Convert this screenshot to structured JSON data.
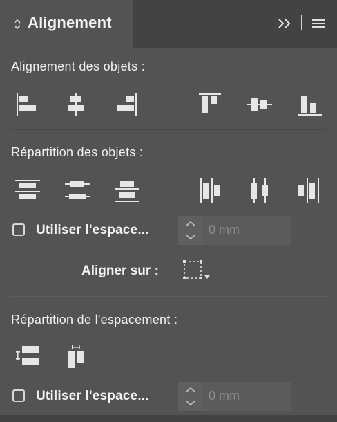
{
  "panel": {
    "tab_title": "Alignement",
    "expand_icon": "double-chevron-right-icon",
    "menu_icon": "hamburger-menu-icon"
  },
  "align_objects": {
    "title": "Alignement des objets :",
    "buttons": [
      {
        "name": "align-left-edges",
        "icon": "align-left-icon"
      },
      {
        "name": "align-horizontal-centers",
        "icon": "align-horizontal-center-icon"
      },
      {
        "name": "align-right-edges",
        "icon": "align-right-icon"
      },
      {
        "name": "align-top-edges",
        "icon": "align-top-icon"
      },
      {
        "name": "align-vertical-centers",
        "icon": "align-vertical-center-icon"
      },
      {
        "name": "align-bottom-edges",
        "icon": "align-bottom-icon"
      }
    ]
  },
  "distribute_objects": {
    "title": "Répartition des objets :",
    "use_spacing_label": "Utiliser l'espace...",
    "spacing_value": "0 mm",
    "use_spacing_checked": false
  },
  "align_to": {
    "label": "Aligner sur :",
    "icon": "selection-align-to-icon"
  },
  "distribute_spacing": {
    "title": "Répartition de l'espacement :",
    "use_spacing_label": "Utiliser l'espace...",
    "spacing_value": "0 mm",
    "use_spacing_checked": false
  },
  "colors": {
    "panel_bg": "#535353",
    "tab_bar_bg": "#434343",
    "text": "#f2f2f2",
    "placeholder": "#8c8c8c"
  }
}
